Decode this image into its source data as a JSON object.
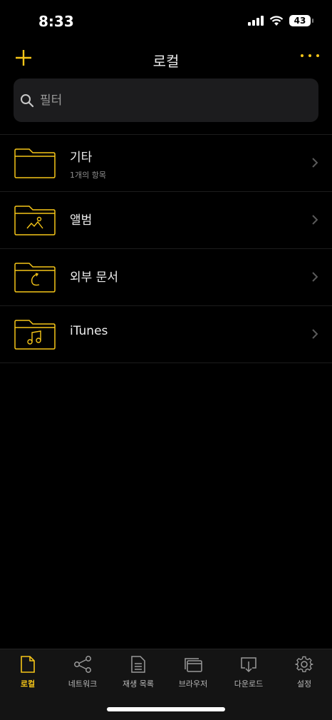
{
  "status": {
    "time": "8:33",
    "battery": "43"
  },
  "header": {
    "title": "로컬"
  },
  "search": {
    "placeholder": "필터"
  },
  "folders": [
    {
      "title": "기타",
      "subtitle": "1개의 항목"
    },
    {
      "title": "앨범"
    },
    {
      "title": "외부 문서"
    },
    {
      "title": "iTunes"
    }
  ],
  "tabs": [
    {
      "label": "로컬",
      "active": true
    },
    {
      "label": "네트워크"
    },
    {
      "label": "재생 목록"
    },
    {
      "label": "브라우저"
    },
    {
      "label": "다운로드"
    },
    {
      "label": "설정"
    }
  ],
  "colors": {
    "accent": "#f5c518",
    "background": "#000000",
    "search_bg": "#1c1c1e"
  }
}
